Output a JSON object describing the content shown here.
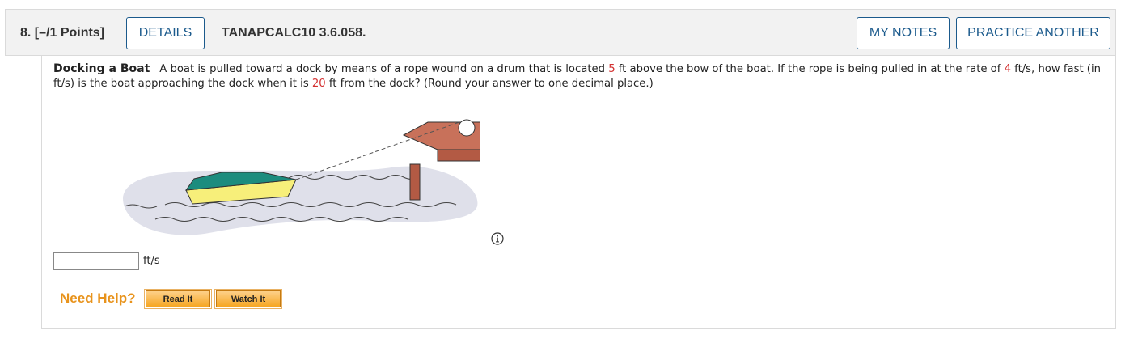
{
  "header": {
    "question_number": "8.",
    "points": "[–/1 Points]",
    "details_label": "DETAILS",
    "problem_code": "TANAPCALC10 3.6.058.",
    "my_notes_label": "MY NOTES",
    "practice_label": "PRACTICE ANOTHER"
  },
  "question": {
    "title": "Docking a Boat",
    "text_1": "A boat is pulled toward a dock by means of a rope wound on a drum that is located ",
    "value_height": "5",
    "text_2": " ft above the bow of the boat. If the rope is being pulled in at the rate of ",
    "value_rate": "4",
    "text_3": " ft/s, how fast (in ft/s) is the boat approaching the dock when it is ",
    "value_distance": "20",
    "text_4": " ft from the dock? (Round your answer to one decimal place.)"
  },
  "answer": {
    "value": "",
    "unit": "ft/s"
  },
  "help": {
    "label": "Need Help?",
    "read_label": "Read It",
    "watch_label": "Watch It"
  },
  "colors": {
    "accent_blue": "#1b5a8c",
    "highlight_red": "#d32f2f",
    "help_orange": "#e8931c"
  },
  "icons": {
    "info": "info-circle-icon"
  }
}
